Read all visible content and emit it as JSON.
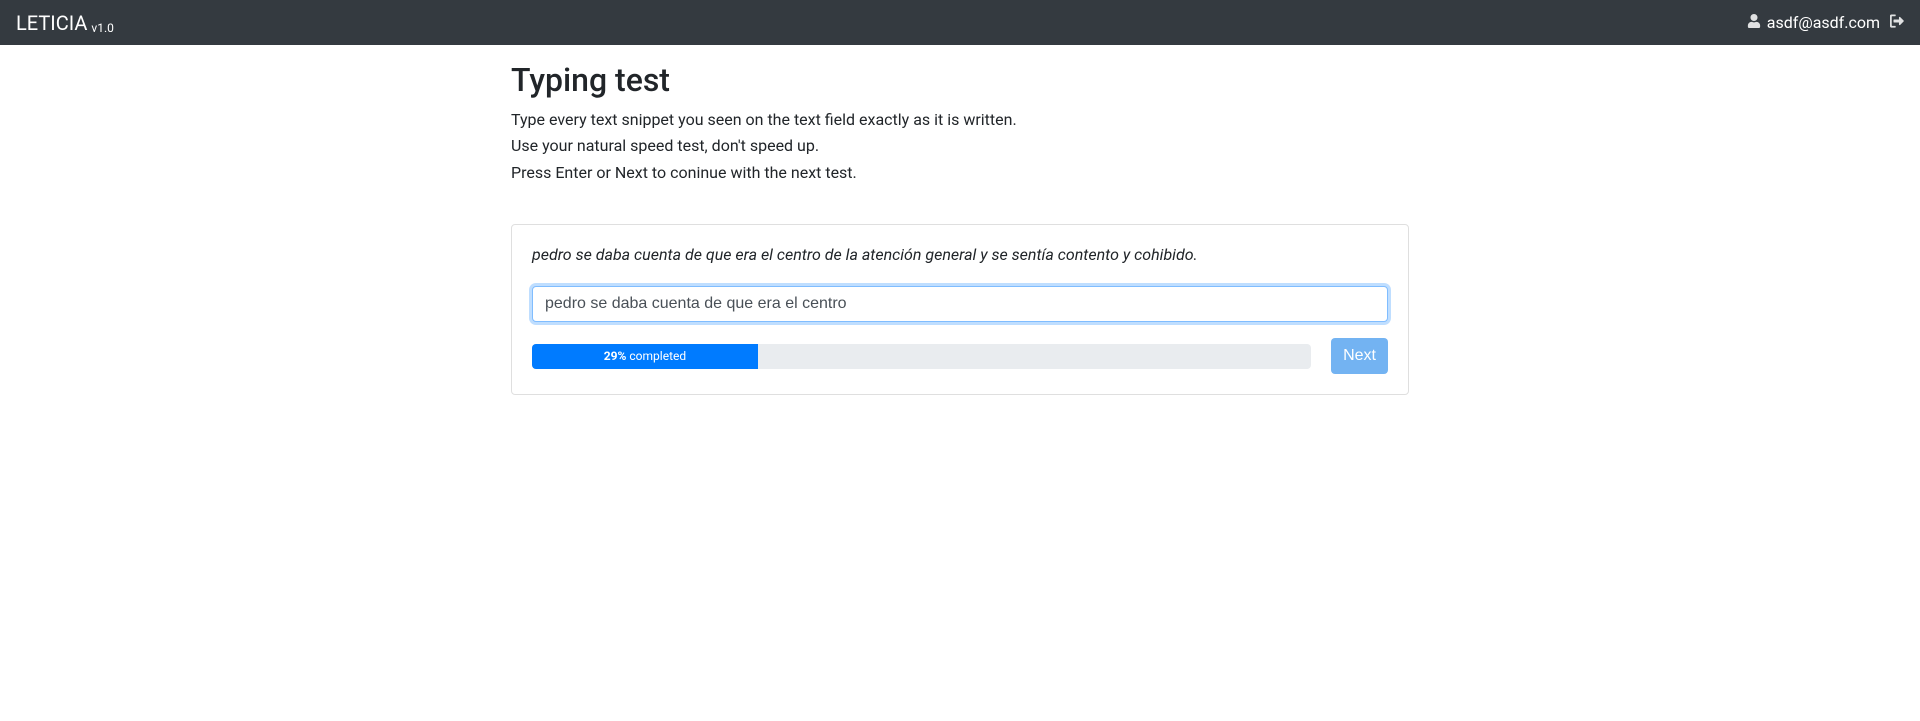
{
  "header": {
    "brand": "LETICIA",
    "version": "v1.0",
    "user_email": "asdf@asdf.com"
  },
  "page": {
    "title": "Typing test",
    "instructions": [
      "Type every text snippet you seen on the text field exactly as it is written.",
      "Use your natural speed test, don't speed up.",
      "Press Enter or Next to coninue with the next test."
    ]
  },
  "test": {
    "snippet": "pedro se daba cuenta de que era el centro de la atención general y se sentía contento y cohibido.",
    "input_value": "pedro se daba cuenta de que era el centro",
    "progress_percent": 29,
    "progress_label_pct": "29%",
    "progress_label_suffix": " completed",
    "next_button": "Next"
  }
}
